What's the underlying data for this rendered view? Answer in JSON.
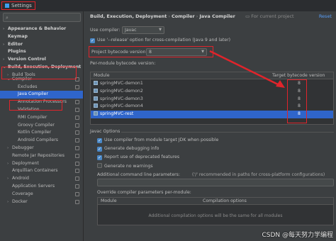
{
  "window": {
    "title": "Settings"
  },
  "search": {
    "placeholder": ""
  },
  "sidebar": {
    "items": [
      {
        "label": "Appearance & Behavior",
        "arrow": "›",
        "bold": true
      },
      {
        "label": "Keymap",
        "arrow": "",
        "bold": true
      },
      {
        "label": "Editor",
        "arrow": "›",
        "bold": true
      },
      {
        "label": "Plugins",
        "arrow": "",
        "bold": true
      },
      {
        "label": "Version Control",
        "arrow": "›",
        "bold": true
      },
      {
        "label": "Build, Execution, Deployment",
        "arrow": "⌄",
        "bold": true
      },
      {
        "label": "Build Tools",
        "arrow": "›",
        "bold": false
      },
      {
        "label": "Compiler",
        "arrow": "⌄",
        "bold": false
      },
      {
        "label": "Excludes",
        "arrow": "",
        "bold": false
      },
      {
        "label": "Java Compiler",
        "arrow": "",
        "bold": false,
        "selected": true
      },
      {
        "label": "Annotation Processors",
        "arrow": "",
        "bold": false
      },
      {
        "label": "Validation",
        "arrow": "",
        "bold": false
      },
      {
        "label": "RMI Compiler",
        "arrow": "",
        "bold": false
      },
      {
        "label": "Groovy Compiler",
        "arrow": "",
        "bold": false
      },
      {
        "label": "Kotlin Compiler",
        "arrow": "",
        "bold": false
      },
      {
        "label": "Android Compilers",
        "arrow": "",
        "bold": false
      },
      {
        "label": "Debugger",
        "arrow": "›",
        "bold": false
      },
      {
        "label": "Remote Jar Repositories",
        "arrow": "",
        "bold": false
      },
      {
        "label": "Deployment",
        "arrow": "›",
        "bold": false
      },
      {
        "label": "Arquillian Containers",
        "arrow": "",
        "bold": false
      },
      {
        "label": "Android",
        "arrow": "›",
        "bold": false
      },
      {
        "label": "Application Servers",
        "arrow": "",
        "bold": false
      },
      {
        "label": "Coverage",
        "arrow": "",
        "bold": false
      },
      {
        "label": "Docker",
        "arrow": "›",
        "bold": false
      }
    ]
  },
  "main": {
    "breadcrumb": [
      "Build, Execution, Deployment",
      "Compiler",
      "Java Compiler"
    ],
    "breadcrumb_scope": "For current project",
    "reset_label": "Reset",
    "use_compiler_label": "Use compiler:",
    "use_compiler_value": "Javac",
    "release_option_label": "Use '--release' option for cross-compilation (Java 9 and later)",
    "bytecode_label": "Project bytecode version:",
    "bytecode_value": "8",
    "per_module_label": "Per-module bytecode version:",
    "table_headers": {
      "module": "Module",
      "target": "Target bytecode version"
    },
    "modules": [
      {
        "name": "springMVC-demon1",
        "version": "8"
      },
      {
        "name": "springMVC-demon2",
        "version": "8"
      },
      {
        "name": "springMVC-demon3",
        "version": "8"
      },
      {
        "name": "springMVC-demon4",
        "version": "8"
      },
      {
        "name": "springMVC-rest",
        "version": "8",
        "selected": true
      }
    ],
    "javac_options_label": "Javac Options",
    "opt_module_jdk": "Use compiler from module target JDK when possible",
    "opt_debug": "Generate debugging info",
    "opt_deprecated": "Report use of deprecated features",
    "opt_no_warnings": "Generate no warnings",
    "additional_params_label": "Additional command line parameters:",
    "additional_params_hint": "('/' recommended in paths for cross-platform configurations)",
    "override_label": "Override compiler parameters per-module:",
    "override_headers": {
      "module": "Module",
      "options": "Compilation options"
    },
    "override_empty": "Additional compilation options will be the same for all modules"
  },
  "watermark": "CSDN @每天努力学编程",
  "colors": {
    "accent": "#2f65ca",
    "highlight": "#e0242b",
    "link": "#589df6"
  }
}
